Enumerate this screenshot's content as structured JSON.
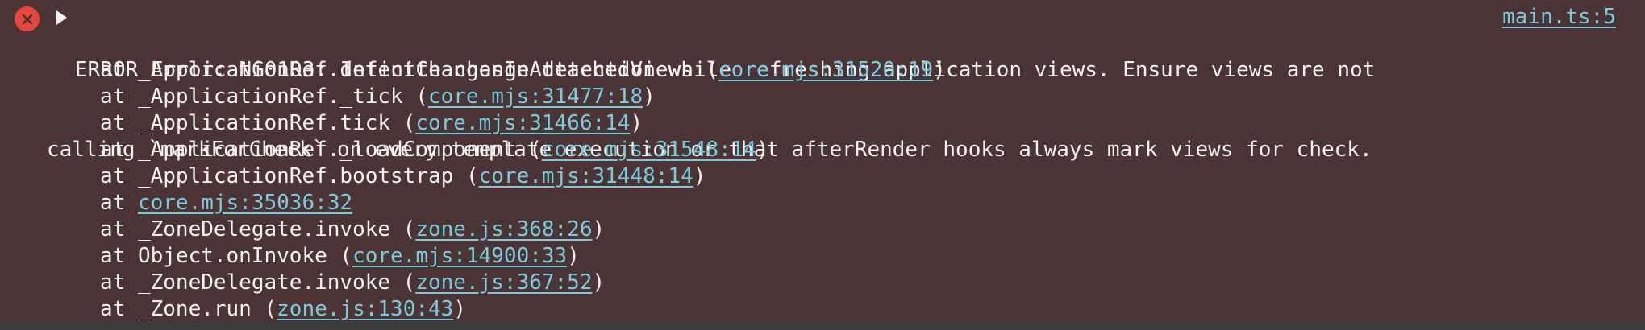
{
  "console": {
    "error_message_line1": "ERROR Error: NG0103: Infinite change detection while refreshing application views. Ensure views are not",
    "error_message_line2": "calling `markForCheck` on every template execution or that afterRender hooks always mark views for check.",
    "source_link": "main.ts:5",
    "stack": [
      {
        "prefix": "at _ApplicationRef.detectChangesInAttachedViews (",
        "link": "core.mjs:31520:19",
        "suffix": ")"
      },
      {
        "prefix": "at _ApplicationRef._tick (",
        "link": "core.mjs:31477:18",
        "suffix": ")"
      },
      {
        "prefix": "at _ApplicationRef.tick (",
        "link": "core.mjs:31466:14",
        "suffix": ")"
      },
      {
        "prefix": "at _ApplicationRef._loadComponent (",
        "link": "core.mjs:31548:14",
        "suffix": ")"
      },
      {
        "prefix": "at _ApplicationRef.bootstrap (",
        "link": "core.mjs:31448:14",
        "suffix": ")"
      },
      {
        "prefix": "at ",
        "link": "core.mjs:35036:32",
        "suffix": ""
      },
      {
        "prefix": "at _ZoneDelegate.invoke (",
        "link": "zone.js:368:26",
        "suffix": ")"
      },
      {
        "prefix": "at Object.onInvoke (",
        "link": "core.mjs:14900:33",
        "suffix": ")"
      },
      {
        "prefix": "at _ZoneDelegate.invoke (",
        "link": "zone.js:367:52",
        "suffix": ")"
      },
      {
        "prefix": "at _Zone.run (",
        "link": "zone.js:130:43",
        "suffix": ")"
      }
    ]
  },
  "icons": {
    "error": "error-circle-x-icon",
    "expand": "disclosure-triangle-icon"
  },
  "colors": {
    "background": "#4b3433",
    "text": "#f2f2f2",
    "link": "#79cbe0",
    "error_icon": "#e5483f"
  }
}
